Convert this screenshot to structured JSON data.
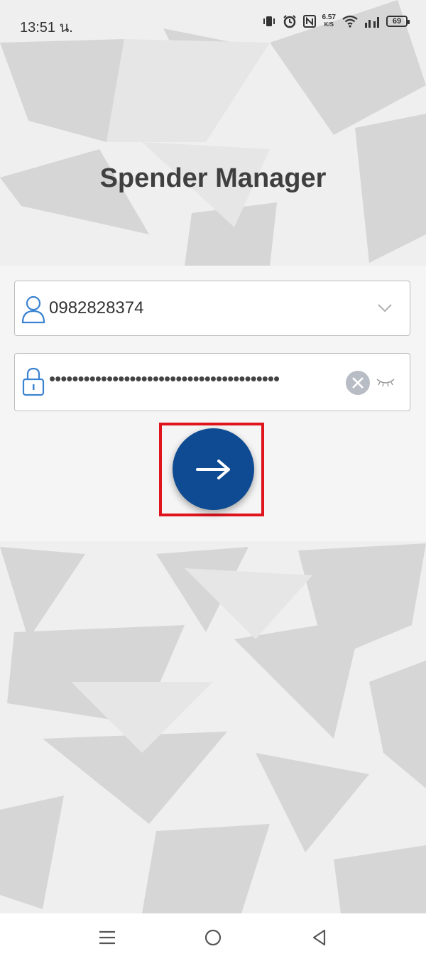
{
  "status_bar": {
    "time": "13:51 น.",
    "net_speed_value": "6.57",
    "net_speed_unit": "K/S",
    "battery": "69"
  },
  "app_title": "Spender Manager",
  "login": {
    "username_value": "0982828374",
    "password_masked": "••••••••••••••••••••••••••••••••••••••••"
  },
  "colors": {
    "primary": "#0e4b92",
    "highlight": "#e0141d",
    "icon_blue": "#3b83d1"
  },
  "icons": {
    "user": "user-icon",
    "lock": "lock-icon",
    "dropdown": "chevron-down-icon",
    "clear": "clear-icon",
    "visibility": "eye-closed-icon",
    "submit": "arrow-right-icon",
    "nav_recents": "menu-icon",
    "nav_home": "home-circle-icon",
    "nav_back": "back-triangle-icon"
  }
}
